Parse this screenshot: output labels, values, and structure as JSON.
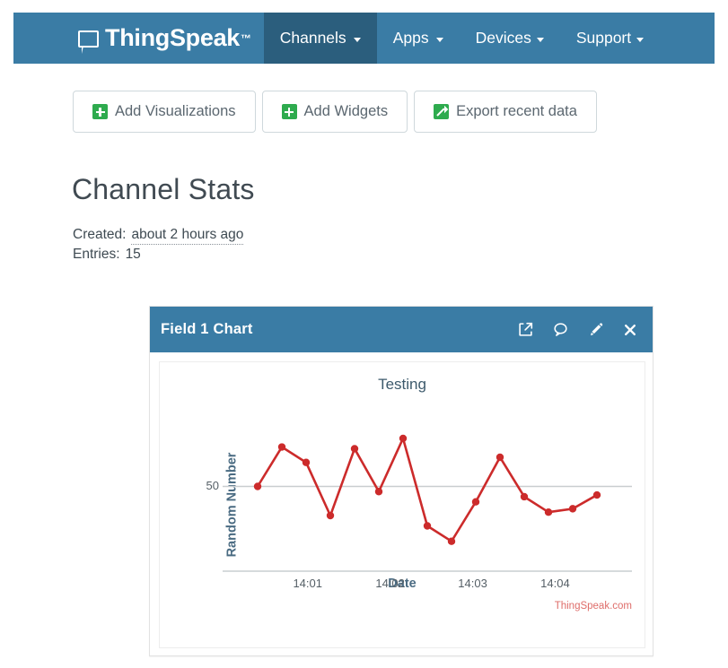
{
  "navbar": {
    "brand": "ThingSpeak",
    "brand_tm": "™",
    "brand_icon": "speech-bubble-icon",
    "items": [
      {
        "label": "Channels",
        "active": true,
        "caret": true
      },
      {
        "label": "Apps",
        "active": false,
        "caret": true
      },
      {
        "label": "Devices",
        "active": false,
        "caret": true
      },
      {
        "label": "Support",
        "active": false,
        "caret": true
      }
    ]
  },
  "actions": [
    {
      "label": "Add Visualizations",
      "icon": "plus-square-icon"
    },
    {
      "label": "Add Widgets",
      "icon": "plus-square-icon"
    },
    {
      "label": "Export recent data",
      "icon": "external-arrow-icon"
    }
  ],
  "stats": {
    "title": "Channel Stats",
    "created_label": "Created:",
    "created_value": "about 2 hours ago",
    "entries_label": "Entries:",
    "entries_value": "15"
  },
  "panel": {
    "title": "Field 1 Chart",
    "icons": [
      {
        "name": "popout-icon",
        "glyph": "↗"
      },
      {
        "name": "comment-icon",
        "glyph": "◯"
      },
      {
        "name": "edit-pencil-icon",
        "glyph": "✎"
      },
      {
        "name": "close-icon",
        "glyph": "✖"
      }
    ],
    "watermark": "ThingSpeak.com"
  },
  "colors": {
    "navbar_blue": "#3a7ca5",
    "navbar_active": "#2b5e7d",
    "icon_green": "#2eab4e",
    "line_red": "#cc2b2b",
    "axis_label_blue": "#4a6b82",
    "watermark_red": "#d9534f"
  },
  "chart_data": {
    "type": "line",
    "title": "Testing",
    "xlabel": "Date",
    "ylabel": "Random Number",
    "grid": true,
    "legend": false,
    "xtick_labels": [
      "14:01",
      "14:02",
      "14:03",
      "14:04"
    ],
    "ytick_labels": [
      "50"
    ],
    "yticks": [
      50
    ],
    "ylim": [
      10,
      90
    ],
    "xlim": [
      0,
      16
    ],
    "x": [
      1,
      2,
      3,
      4,
      5,
      6,
      7,
      8,
      9,
      10,
      11,
      12,
      13,
      14,
      15
    ],
    "values": [
      50,
      73,
      64,
      33,
      72,
      47,
      78,
      27,
      18,
      41,
      67,
      44,
      35,
      37,
      45
    ],
    "series": [
      {
        "name": "Field 1",
        "color": "#cc2b2b",
        "values": [
          50,
          73,
          64,
          33,
          72,
          47,
          78,
          27,
          18,
          41,
          67,
          44,
          35,
          37,
          45
        ]
      }
    ]
  }
}
